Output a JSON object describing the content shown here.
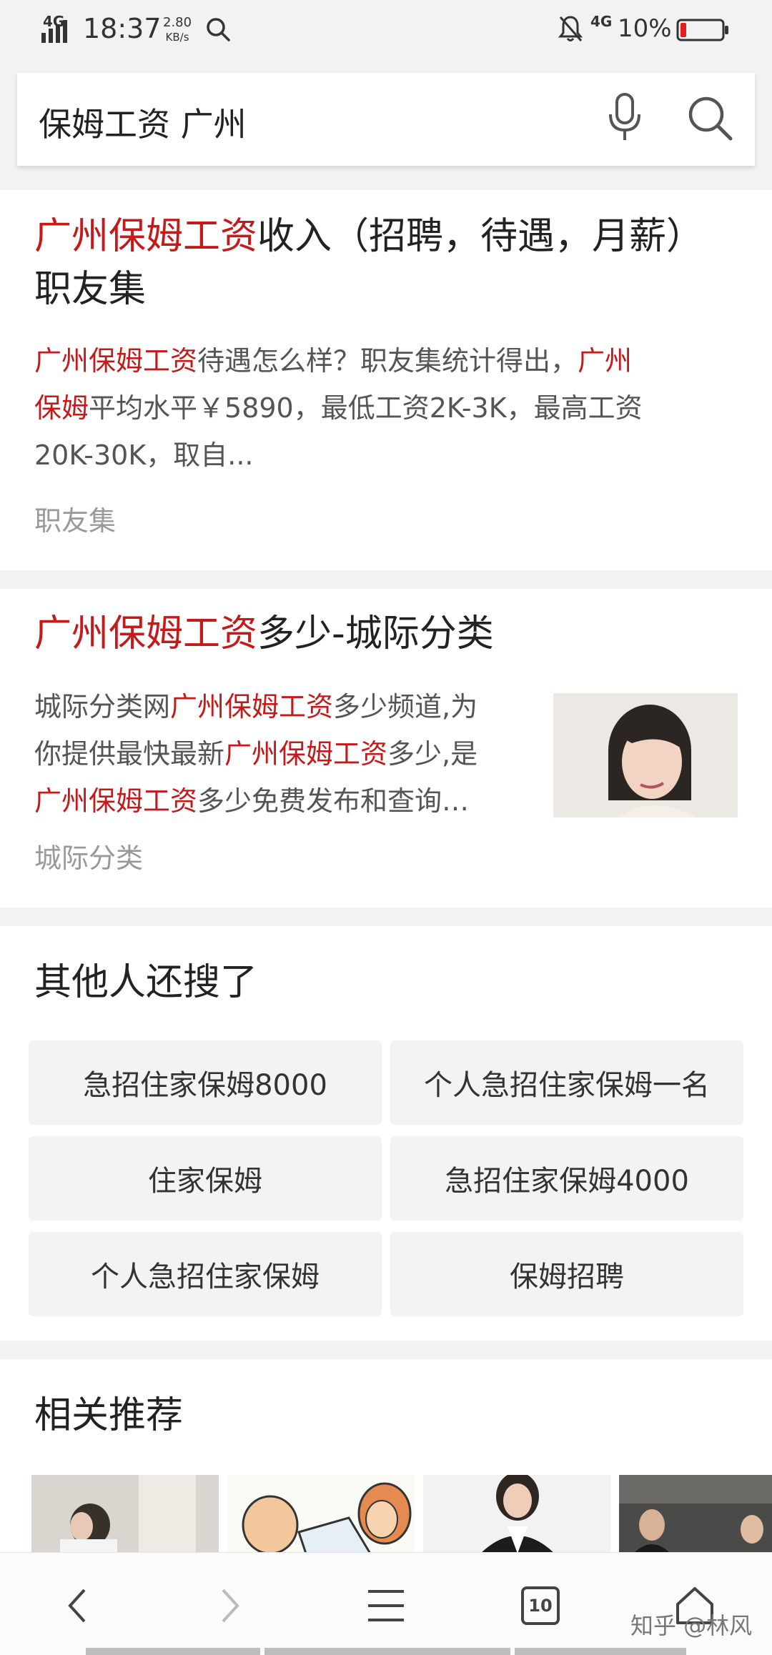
{
  "status_bar": {
    "network": "4G",
    "time": "18:37",
    "speed_value": "2.80",
    "speed_unit": "KB/s",
    "network_right": "4G",
    "battery": "10%"
  },
  "search": {
    "query": "保姆工资 广州"
  },
  "results": [
    {
      "title_highlight": "广州保姆工资",
      "title_rest": "收入（招聘，待遇，月薪）",
      "title_line2": "职友集",
      "snippet_l1_hl": "广州保姆工资",
      "snippet_l1_rest": "待遇怎么样？职友集统计得出，",
      "snippet_l1_hl2": "广州",
      "snippet_l2_hl": "保姆",
      "snippet_l2_rest": "平均水平￥5890，最低工资2K-3K，最高工资",
      "snippet_l3": "20K-30K，取自...",
      "source": "职友集"
    },
    {
      "title_highlight": "广州保姆工资",
      "title_rest": "多少-城际分类",
      "snippet_l1_a": "城际分类网",
      "snippet_l1_hl": "广州保姆工资",
      "snippet_l1_b": "多少频道,为",
      "snippet_l2_a": "你提供最快最新",
      "snippet_l2_hl": "广州保姆工资",
      "snippet_l2_b": "多少,是",
      "snippet_l3_hl": "广州保姆工资",
      "snippet_l3_b": "多少免费发布和查询…",
      "source": "城际分类"
    }
  ],
  "others_searched": {
    "title": "其他人还搜了",
    "items": [
      "急招住家保姆8000",
      "个人急招住家保姆一名",
      "住家保姆",
      "急招住家保姆4000",
      "个人急招住家保姆",
      "保姆招聘"
    ]
  },
  "related": {
    "title": "相关推荐"
  },
  "bottom_nav": {
    "tabs_count": "10",
    "watermark": "知乎 @林风"
  },
  "colors": {
    "highlight": "#c61a1a",
    "background": "#f2f2f2"
  }
}
